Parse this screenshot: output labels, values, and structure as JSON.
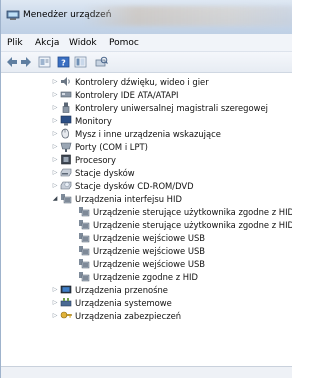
{
  "window": {
    "title": "Menedżer urządzeń"
  },
  "menu": [
    "Plik",
    "Akcja",
    "Widok",
    "Pomoc"
  ],
  "toolbar": [
    {
      "name": "back-arrow-icon"
    },
    {
      "name": "forward-arrow-icon"
    },
    {
      "name": "properties-icon"
    },
    {
      "name": "help-icon"
    },
    {
      "name": "view-icon"
    },
    {
      "name": "scan-hardware-icon"
    }
  ],
  "tree": {
    "nodes": [
      {
        "label": "Kontrolery dźwięku, wideo i gier",
        "icon": "sound-icon",
        "expander": "▷"
      },
      {
        "label": "Kontrolery IDE ATA/ATAPI",
        "icon": "ide-controller-icon",
        "expander": "▷"
      },
      {
        "label": "Kontrolery uniwersalnej magistrali szeregowej",
        "icon": "usb-controller-icon",
        "expander": "▷"
      },
      {
        "label": "Monitory",
        "icon": "monitor-icon",
        "expander": "▷"
      },
      {
        "label": "Mysz i inne urządzenia wskazujące",
        "icon": "mouse-icon",
        "expander": "▷"
      },
      {
        "label": "Porty (COM i LPT)",
        "icon": "port-icon",
        "expander": "▷"
      },
      {
        "label": "Procesory",
        "icon": "processor-icon",
        "expander": "▷"
      },
      {
        "label": "Stacje dysków",
        "icon": "disk-drive-icon",
        "expander": "▷"
      },
      {
        "label": "Stacje dysków CD-ROM/DVD",
        "icon": "cdrom-icon",
        "expander": "▷"
      },
      {
        "label": "Urządzenia interfejsu HID",
        "icon": "hid-icon",
        "expander": "◢",
        "expanded": true
      },
      {
        "label": "Urządzenie sterujące użytkownika zgodne z HID",
        "icon": "hid-device-icon",
        "child": true
      },
      {
        "label": "Urządzenie sterujące użytkownika zgodne z HID",
        "icon": "hid-device-icon",
        "child": true
      },
      {
        "label": "Urządzenie wejściowe USB",
        "icon": "hid-device-icon",
        "child": true
      },
      {
        "label": "Urządzenie wejściowe USB",
        "icon": "hid-device-icon",
        "child": true
      },
      {
        "label": "Urządzenie wejściowe USB",
        "icon": "hid-device-icon",
        "child": true
      },
      {
        "label": "Urządzenie zgodne z HID",
        "icon": "hid-device-icon",
        "child": true
      },
      {
        "label": "Urządzenia przenośne",
        "icon": "portable-device-icon",
        "expander": "▷"
      },
      {
        "label": "Urządzenia systemowe",
        "icon": "system-device-icon",
        "expander": "▷"
      },
      {
        "label": "Urządzenia zabezpieczeń",
        "icon": "security-device-icon",
        "expander": "▷"
      }
    ]
  }
}
